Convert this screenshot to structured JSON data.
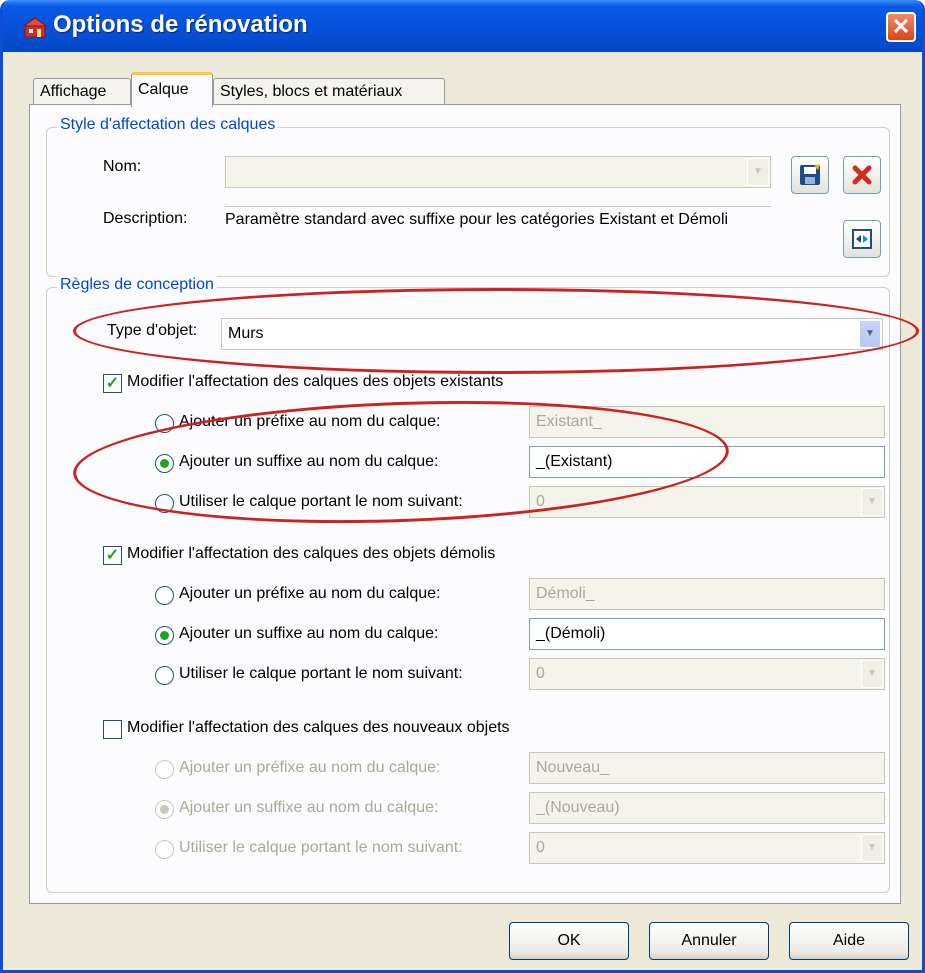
{
  "window": {
    "title": "Options de rénovation"
  },
  "tabs": [
    {
      "label": "Affichage",
      "active": false
    },
    {
      "label": "Calque",
      "active": true
    },
    {
      "label": "Styles, blocs et matériaux",
      "active": false
    }
  ],
  "style_group": {
    "legend": "Style d'affectation des calques",
    "name_label": "Nom:",
    "name_value": "",
    "description_label": "Description:",
    "description_value": "Paramètre standard avec suffixe pour les catégories Existant et Démoli"
  },
  "rules": {
    "legend": "Règles de conception",
    "object_type_label": "Type d'objet:",
    "object_type_value": "Murs",
    "sections": [
      {
        "checkbox_label": "Modifier l'affectation des calques des objets existants",
        "checked": true,
        "prefix_label": "Ajouter un préfixe au nom du calque:",
        "prefix_value": "Existant_",
        "suffix_label": "Ajouter un suffixe au nom du calque:",
        "suffix_value": "_(Existant)",
        "named_label": "Utiliser le calque portant le nom suivant:",
        "named_value": "0",
        "selected": "suffix"
      },
      {
        "checkbox_label": "Modifier l'affectation des calques des objets démolis",
        "checked": true,
        "prefix_label": "Ajouter un préfixe au nom du calque:",
        "prefix_value": "Démoli_",
        "suffix_label": "Ajouter un suffixe au nom du calque:",
        "suffix_value": "_(Démoli)",
        "named_label": "Utiliser le calque portant le nom suivant:",
        "named_value": "0",
        "selected": "suffix"
      },
      {
        "checkbox_label": "Modifier l'affectation des calques des nouveaux objets",
        "checked": false,
        "prefix_label": "Ajouter un préfixe au nom du calque:",
        "prefix_value": "Nouveau_",
        "suffix_label": "Ajouter un suffixe au nom du calque:",
        "suffix_value": "_(Nouveau)",
        "named_label": "Utiliser le calque portant le nom suivant:",
        "named_value": "0",
        "selected": "suffix"
      }
    ]
  },
  "buttons": {
    "ok": "OK",
    "cancel": "Annuler",
    "help": "Aide"
  },
  "colors": {
    "title_bar": "#0650d9",
    "close": "#d9441c",
    "legend": "#0046d5",
    "check": "#21a121",
    "annotation": "#cc2222"
  }
}
